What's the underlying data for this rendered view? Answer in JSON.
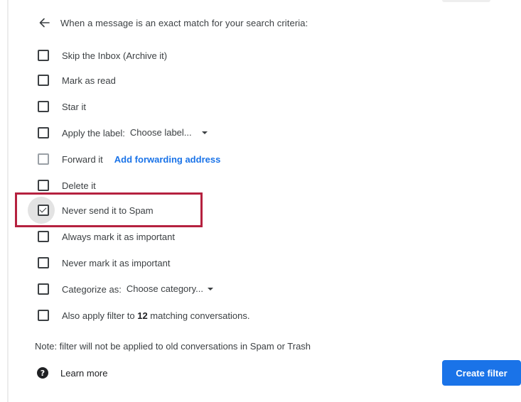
{
  "header": {
    "text": "When a message is an exact match for your search criteria:",
    "back_icon": "arrow-left-icon"
  },
  "options": {
    "skip_inbox": {
      "label": "Skip the Inbox (Archive it)",
      "checked": false
    },
    "mark_read": {
      "label": "Mark as read",
      "checked": false
    },
    "star": {
      "label": "Star it",
      "checked": false
    },
    "apply_label": {
      "label": "Apply the label:",
      "checked": false,
      "select_value": "Choose label..."
    },
    "forward": {
      "label": "Forward it",
      "checked": false,
      "enabled": false,
      "link": "Add forwarding address"
    },
    "delete": {
      "label": "Delete it",
      "checked": false
    },
    "never_spam": {
      "label": "Never send it to Spam",
      "checked": true
    },
    "always_important": {
      "label": "Always mark it as important",
      "checked": false
    },
    "never_important": {
      "label": "Never mark it as important",
      "checked": false
    },
    "categorize": {
      "label": "Categorize as:",
      "checked": false,
      "select_value": "Choose category..."
    },
    "also_apply": {
      "label_prefix": "Also apply filter to ",
      "count": "12",
      "label_suffix": " matching conversations.",
      "checked": false
    }
  },
  "note": "Note: filter will not be applied to old conversations in Spam or Trash",
  "learn_more": {
    "label": "Learn more",
    "icon": "help-icon"
  },
  "create_button": {
    "label": "Create filter"
  },
  "colors": {
    "accent": "#1a73e8",
    "highlight": "#b5213f"
  }
}
